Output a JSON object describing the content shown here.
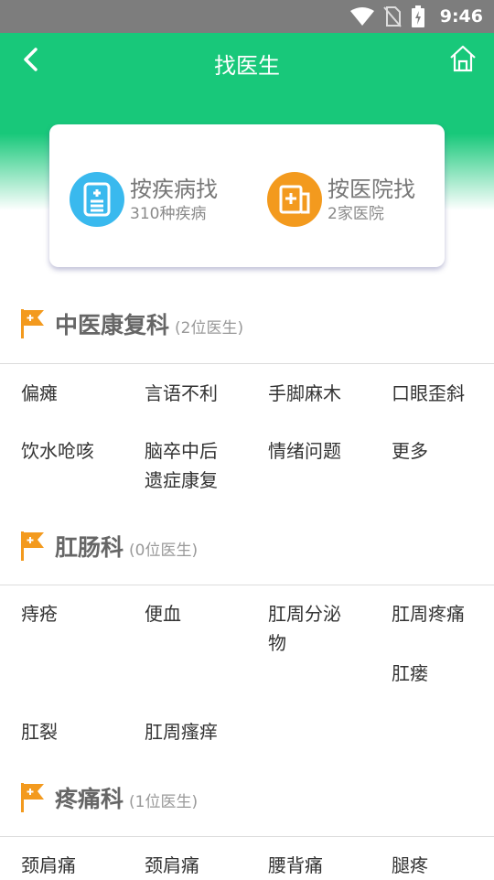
{
  "status_bar": {
    "time": "9:46"
  },
  "header": {
    "title": "找医生"
  },
  "search_card": {
    "by_disease": {
      "title": "按疾病找",
      "subtitle": "310种疾病"
    },
    "by_hospital": {
      "title": "按医院找",
      "subtitle": "2家医院"
    }
  },
  "sections": [
    {
      "title": "中医康复科",
      "count": "(2位医生)",
      "items": [
        "偏瘫",
        "言语不利",
        "手脚麻木",
        "口眼歪斜",
        "饮水呛咳",
        "脑卒中后遗症康复",
        "情绪问题",
        "更多"
      ]
    },
    {
      "title": "肛肠科",
      "count": "(0位医生)",
      "items": [
        "痔疮",
        "便血",
        "肛周分泌物",
        "肛周疼痛",
        "肛瘘",
        "肛裂",
        "肛周瘙痒"
      ]
    },
    {
      "title": "疼痛科",
      "count": "(1位医生)",
      "items": [
        "颈肩痛",
        "颈肩痛",
        "腰背痛",
        "腿疼"
      ]
    }
  ],
  "colors": {
    "brand_green": "#18c87a",
    "flag_orange": "#f39a1e",
    "disease_blue": "#39b9ee"
  },
  "icons": [
    "back-arrow-icon",
    "home-icon",
    "wifi-icon",
    "no-sim-icon",
    "battery-icon",
    "medical-record-icon",
    "hospital-icon",
    "flag-icon"
  ]
}
